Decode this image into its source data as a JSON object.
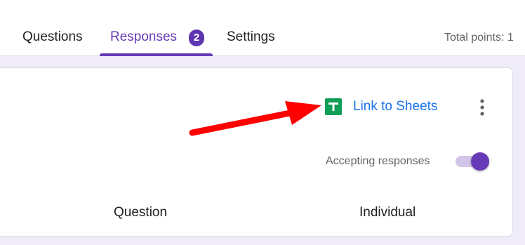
{
  "tabs": [
    {
      "label": "Questions",
      "active": false
    },
    {
      "label": "Responses",
      "active": true,
      "badge": "2"
    },
    {
      "label": "Settings",
      "active": false
    }
  ],
  "total_points": "Total points: 1",
  "card": {
    "link_sheets_label": "Link to Sheets",
    "sheets_icon": "google-sheets-icon",
    "more_icon": "more-vert-icon",
    "accepting_label": "Accepting responses",
    "accepting_on": true,
    "subtabs": [
      "Question",
      "Individual"
    ]
  },
  "annotation": {
    "arrow_color": "#ff0000"
  },
  "colors": {
    "accent": "#673ab7",
    "background": "#f0ebf8",
    "link": "#1a73e8",
    "sheets_green": "#0f9d58"
  }
}
